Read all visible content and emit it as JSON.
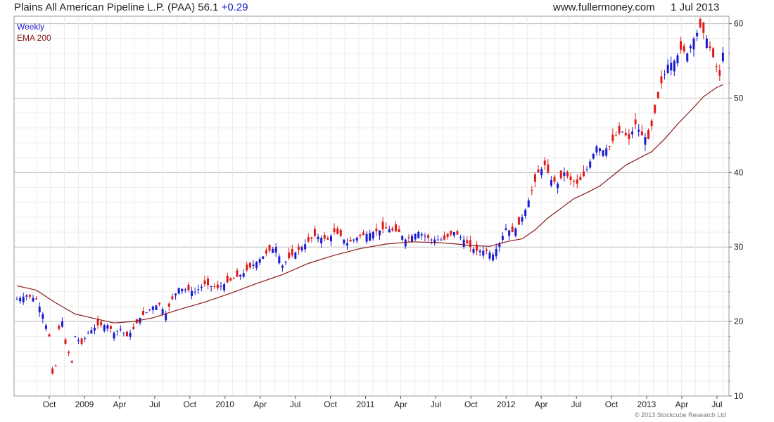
{
  "header": {
    "title": "Plains All American Pipeline L.P. (PAA)",
    "price": "56.1",
    "change": "+0.29",
    "site": "www.fullermoney.com",
    "date": "1 Jul 2013"
  },
  "copyright": "© 2013 Stockcube Research Ltd",
  "chart_data": {
    "type": "candlestick",
    "title": "Plains All American Pipeline L.P. (PAA)",
    "frequency": "Weekly",
    "overlay": "EMA 200",
    "legend": [
      "Weekly",
      "EMA 200"
    ],
    "legend_position": "top-left",
    "ylim": [
      10,
      61
    ],
    "y_ticks": [
      10,
      20,
      30,
      40,
      50,
      60
    ],
    "x_ticks": [
      "Oct",
      "2009",
      "Apr",
      "Jul",
      "Oct",
      "2010",
      "Apr",
      "Jul",
      "Oct",
      "2011",
      "Apr",
      "Jul",
      "Oct",
      "2012",
      "Apr",
      "Jul",
      "Oct",
      "2013",
      "Apr",
      "Jul"
    ],
    "grid": true,
    "colors": {
      "up": "#1a1ad0",
      "down": "#e01a1a",
      "ema": "#8b1a1a",
      "grid": "#d9d9d9"
    },
    "price_path": [
      [
        0,
        23
      ],
      [
        3,
        23.5
      ],
      [
        6,
        23
      ],
      [
        8,
        21
      ],
      [
        10,
        18
      ],
      [
        11,
        13
      ],
      [
        12,
        14
      ],
      [
        13,
        19
      ],
      [
        14,
        20
      ],
      [
        15,
        17
      ],
      [
        17,
        14.5
      ],
      [
        18,
        18
      ],
      [
        20,
        17
      ],
      [
        22,
        18.5
      ],
      [
        25,
        19.5
      ],
      [
        28,
        19.5
      ],
      [
        30,
        18.5
      ],
      [
        32,
        19
      ],
      [
        34,
        18
      ],
      [
        36,
        19
      ],
      [
        38,
        20.5
      ],
      [
        42,
        22
      ],
      [
        44,
        22.3
      ],
      [
        46,
        21
      ],
      [
        48,
        23
      ],
      [
        50,
        24.5
      ],
      [
        55,
        24
      ],
      [
        58,
        25
      ],
      [
        62,
        24.5
      ],
      [
        66,
        25.5
      ],
      [
        70,
        26.5
      ],
      [
        74,
        28
      ],
      [
        78,
        29.5
      ],
      [
        80,
        30
      ],
      [
        82,
        27.5
      ],
      [
        84,
        28.5
      ],
      [
        88,
        30
      ],
      [
        92,
        31.5
      ],
      [
        96,
        31
      ],
      [
        98,
        32
      ],
      [
        100,
        31.5
      ],
      [
        102,
        30.5
      ],
      [
        106,
        31.5
      ],
      [
        110,
        32
      ],
      [
        114,
        32.5
      ],
      [
        118,
        32
      ],
      [
        120,
        31
      ],
      [
        124,
        32
      ],
      [
        128,
        31
      ],
      [
        132,
        31
      ],
      [
        135,
        32
      ],
      [
        138,
        31
      ],
      [
        140,
        30
      ],
      [
        142,
        29.5
      ],
      [
        145,
        29.5
      ],
      [
        147,
        29
      ],
      [
        149,
        30.5
      ],
      [
        151,
        32.5
      ],
      [
        153,
        32
      ],
      [
        155,
        33
      ],
      [
        157,
        35
      ],
      [
        159,
        37.5
      ],
      [
        161,
        40
      ],
      [
        163,
        41
      ],
      [
        165,
        39
      ],
      [
        167,
        38.5
      ],
      [
        169,
        40
      ],
      [
        171,
        39
      ],
      [
        173,
        38.5
      ],
      [
        175,
        39.5
      ],
      [
        177,
        41.5
      ],
      [
        179,
        43.5
      ],
      [
        181,
        43
      ],
      [
        183,
        43.5
      ],
      [
        185,
        45
      ],
      [
        187,
        45.5
      ],
      [
        189,
        44.5
      ],
      [
        191,
        46.5
      ],
      [
        193,
        45
      ],
      [
        195,
        44.5
      ],
      [
        197,
        48
      ],
      [
        199,
        52
      ],
      [
        201,
        54.5
      ],
      [
        203,
        55
      ],
      [
        205,
        56.5
      ],
      [
        207,
        56
      ],
      [
        209,
        58
      ],
      [
        211,
        59.5
      ],
      [
        213,
        58
      ],
      [
        215,
        55.5
      ],
      [
        217,
        53
      ],
      [
        218,
        56.1
      ]
    ],
    "ema_200": [
      [
        0,
        24.8
      ],
      [
        6,
        24.2
      ],
      [
        12,
        22.5
      ],
      [
        18,
        21
      ],
      [
        24,
        20.4
      ],
      [
        30,
        19.8
      ],
      [
        36,
        20
      ],
      [
        42,
        20.5
      ],
      [
        50,
        21.6
      ],
      [
        58,
        22.6
      ],
      [
        66,
        23.8
      ],
      [
        74,
        25.1
      ],
      [
        82,
        26.3
      ],
      [
        90,
        27.8
      ],
      [
        98,
        28.9
      ],
      [
        106,
        29.8
      ],
      [
        114,
        30.4
      ],
      [
        122,
        30.7
      ],
      [
        130,
        30.6
      ],
      [
        136,
        30.4
      ],
      [
        140,
        30.2
      ],
      [
        146,
        30.1
      ],
      [
        152,
        30.8
      ],
      [
        156,
        31.1
      ],
      [
        160,
        32.3
      ],
      [
        164,
        33.9
      ],
      [
        168,
        35.2
      ],
      [
        172,
        36.5
      ],
      [
        176,
        37.3
      ],
      [
        180,
        38.2
      ],
      [
        184,
        39.6
      ],
      [
        188,
        41
      ],
      [
        192,
        41.9
      ],
      [
        196,
        42.8
      ],
      [
        200,
        44.5
      ],
      [
        204,
        46.5
      ],
      [
        208,
        48.3
      ],
      [
        212,
        50.2
      ],
      [
        216,
        51.4
      ],
      [
        218,
        51.8
      ]
    ]
  }
}
